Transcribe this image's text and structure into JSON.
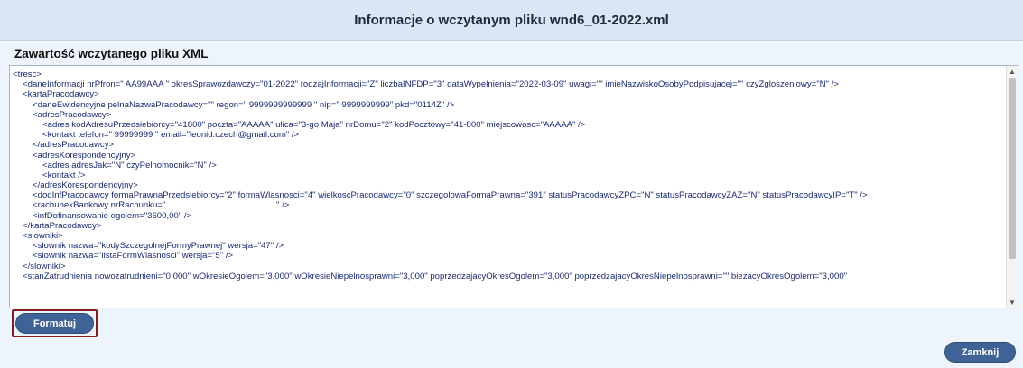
{
  "dialog": {
    "title": "Informacje o wczytanym pliku wnd6_01-2022.xml"
  },
  "section": {
    "title": "Zawartość wczytanego pliku XML"
  },
  "xml_lines": [
    {
      "indent": 0,
      "text": "<tresc>"
    },
    {
      "indent": 1,
      "text": "<daneInformacji nrPfron=\" AA99AAA \" okresSprawozdawczy=\"01-2022\" rodzajInformacji=\"Z\" liczbaINFDP=\"3\" dataWypelnienia=\"2022-03-09\" uwagi=\"\" imieNazwiskoOsobyPodpisujacej=\"\" czyZgloszeniowy=\"N\" />"
    },
    {
      "indent": 1,
      "text": "<kartaPracodawcy>"
    },
    {
      "indent": 2,
      "text": "<daneEwidencyjne pelnaNazwaPracodawcy=\"\" regon=\" 9999999999999 \" nip=\" 9999999999\" pkd=\"0114Z\" />"
    },
    {
      "indent": 2,
      "text": "<adresPracodawcy>"
    },
    {
      "indent": 3,
      "text": "<adres kodAdresuPrzedsiebiorcy=\"41800\" poczta=\"AAAAA\" ulica=\"3-go Maja\" nrDomu=\"2\" kodPocztowy=\"41-800\" miejscowosc=\"AAAAA\" />"
    },
    {
      "indent": 3,
      "text": "<kontakt telefon=\" 99999999 \" email=\"leonid.czech@gmail.com\" />"
    },
    {
      "indent": 2,
      "text": "</adresPracodawcy>"
    },
    {
      "indent": 2,
      "text": "<adresKorespondencyjny>"
    },
    {
      "indent": 3,
      "text": "<adres adresJak=\"N\" czyPelnomocnik=\"N\" />"
    },
    {
      "indent": 3,
      "text": "<kontakt />"
    },
    {
      "indent": 2,
      "text": "</adresKorespondencyjny>"
    },
    {
      "indent": 2,
      "text": "<dodInfPracodawcy formaPrawnaPrzedsiebiorcy=\"2\" formaWlasnosci=\"4\" wielkoscPracodawcy=\"0\" szczegolowaFormaPrawna=\"391\" statusPracodawcyZPC=\"N\" statusPracodawcyZAZ=\"N\" statusPracodawcyIP=\"T\" />"
    },
    {
      "indent": 2,
      "text": "<rachunekBankowy nrRachunku=\"                                              \" />"
    },
    {
      "indent": 2,
      "text": "<infDofinansowanie ogolem=\"3600,00\" />"
    },
    {
      "indent": 1,
      "text": "</kartaPracodawcy>"
    },
    {
      "indent": 1,
      "text": "<slowniki>"
    },
    {
      "indent": 2,
      "text": "<slownik nazwa=\"kodySzczegolnejFormyPrawnej\" wersja=\"47\" />"
    },
    {
      "indent": 2,
      "text": "<slownik nazwa=\"listaFormWlasnosci\" wersja=\"5\" />"
    },
    {
      "indent": 1,
      "text": "</slowniki>"
    },
    {
      "indent": 1,
      "text": "<stanZatrudnienia nowozatrudnieni=\"0,000\" wOkresieOgolem=\"3,000\" wOkresieNiepelnosprawni=\"3,000\" poprzedzajacyOkresOgolem=\"3,000\" poprzedzajacyOkresNiepelnosprawni=\"\" biezacyOkresOgolem=\"3,000\""
    }
  ],
  "buttons": {
    "format": "Formatuj",
    "close": "Zamknij"
  },
  "scrollbar": {
    "up_icon": "▲",
    "down_icon": "▼",
    "position": 0.0
  },
  "colors": {
    "title_bar": "#d9e6f5",
    "button": "#3f6396",
    "xml_text": "#1a2a7a",
    "focus_outline": "#8b1a1a"
  }
}
